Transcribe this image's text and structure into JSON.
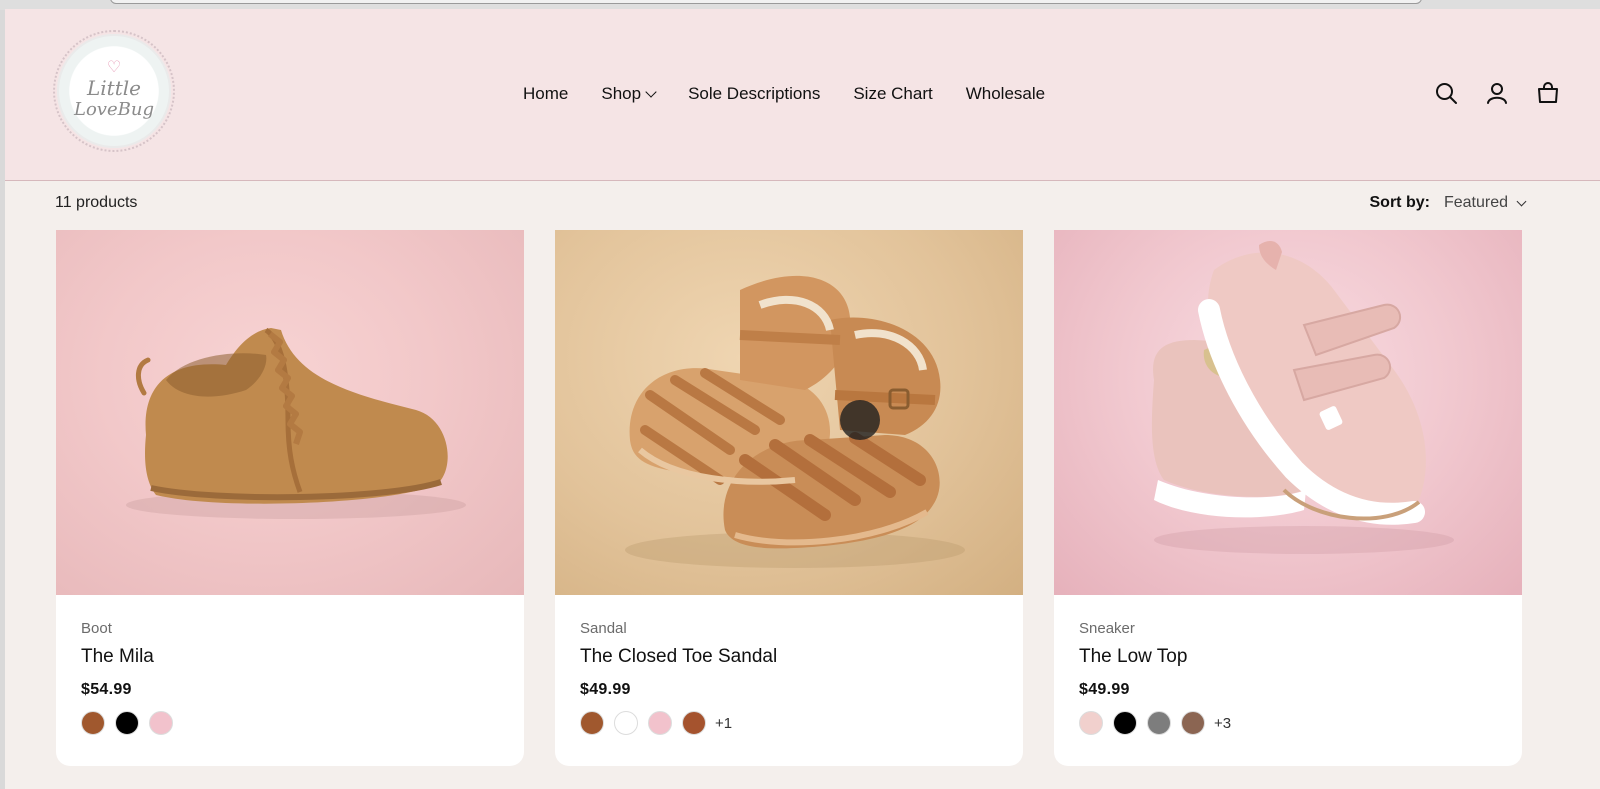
{
  "header": {
    "logo": {
      "line1": "Little",
      "line2": "LoveBug"
    },
    "nav": [
      {
        "label": "Home"
      },
      {
        "label": "Shop"
      },
      {
        "label": "Sole Descriptions"
      },
      {
        "label": "Size Chart"
      },
      {
        "label": "Wholesale"
      }
    ],
    "icons": [
      "search-icon",
      "account-icon",
      "cart-icon"
    ]
  },
  "collection": {
    "count_text": "11 products",
    "sort_label": "Sort by:",
    "sort_value": "Featured"
  },
  "products": [
    {
      "vendor": "Boot",
      "title": "The Mila",
      "price": "$54.99",
      "swatches": [
        "#a0582e",
        "#000000",
        "#f2c2cc"
      ],
      "more": ""
    },
    {
      "vendor": "Sandal",
      "title": "The Closed Toe Sandal",
      "price": "$49.99",
      "swatches": [
        "#a0582e",
        "#ffffff",
        "#f2c2cc",
        "#a5532e"
      ],
      "more": "+1"
    },
    {
      "vendor": "Sneaker",
      "title": "The Low Top",
      "price": "$49.99",
      "swatches": [
        "#f1d0cd",
        "#000000",
        "#7d7d7d",
        "#8b6552"
      ],
      "more": "+3"
    }
  ],
  "colors": {
    "header_bg": "#f5e4e5",
    "page_bg": "#f4efec"
  }
}
